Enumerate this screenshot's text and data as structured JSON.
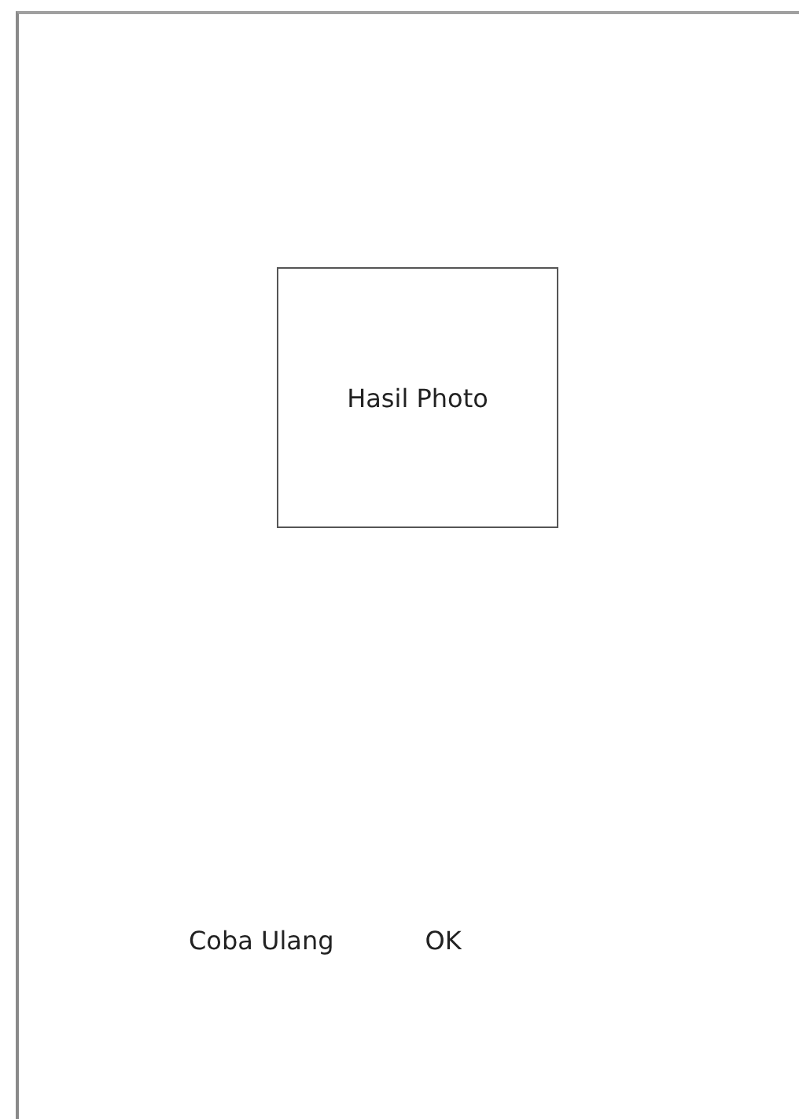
{
  "photo_frame": {
    "label": "Hasil Photo"
  },
  "buttons": [
    {
      "label": "Coba Ulang"
    },
    {
      "label": "OK"
    }
  ]
}
